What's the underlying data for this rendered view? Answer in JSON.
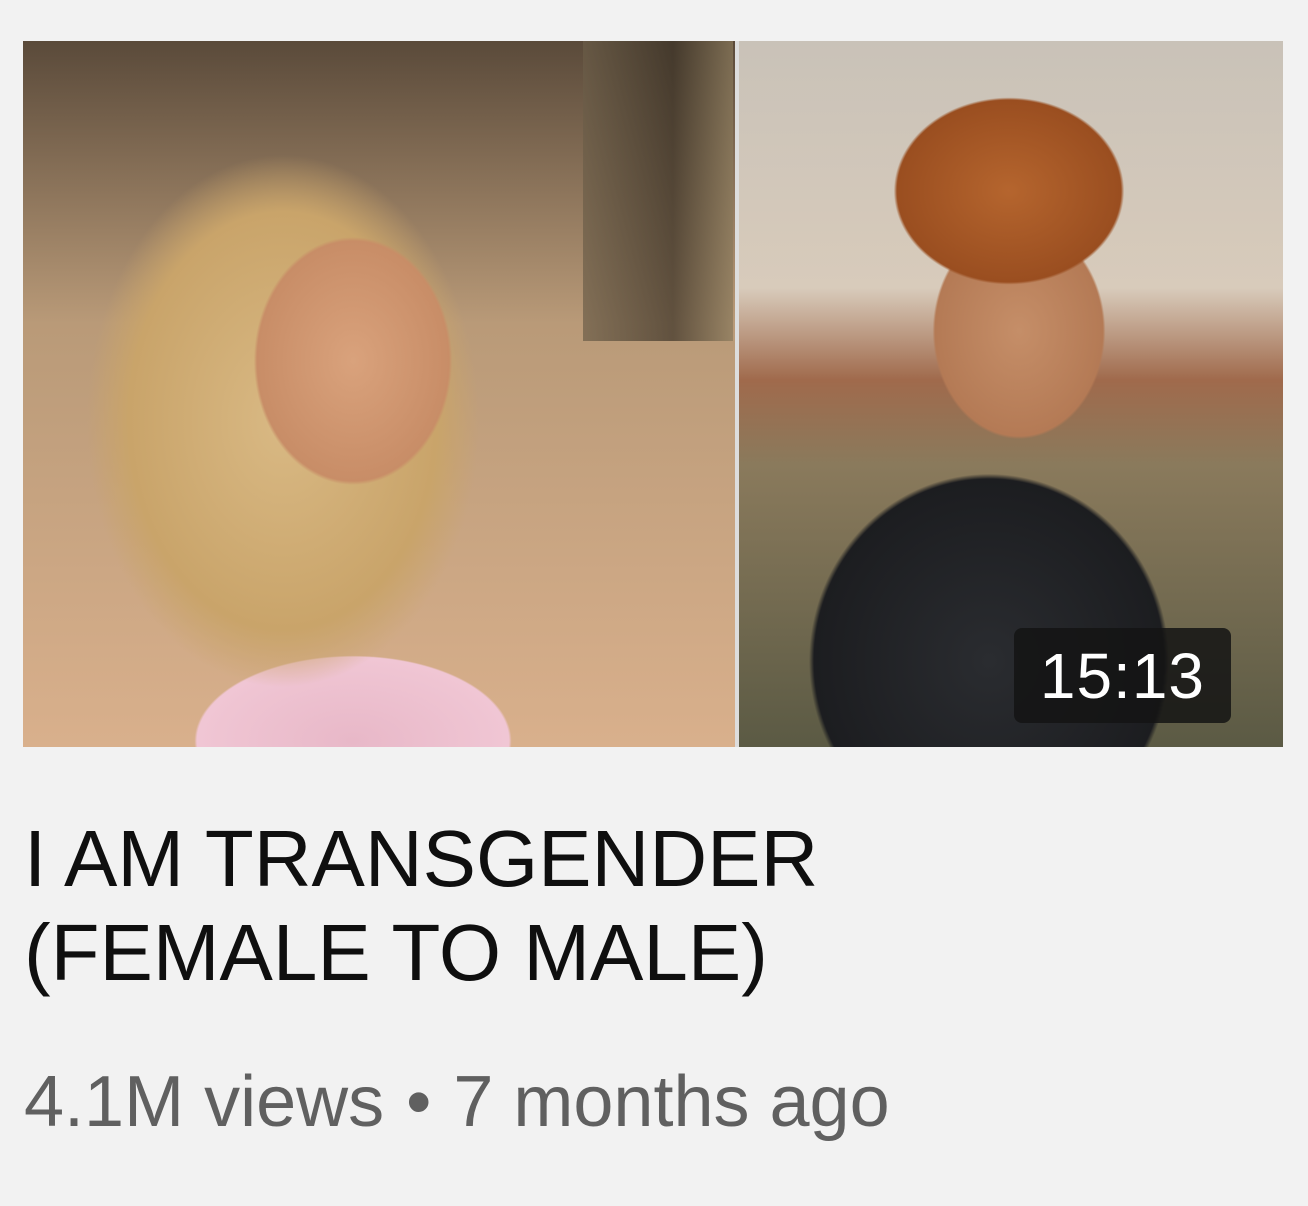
{
  "video": {
    "duration": "15:13",
    "title": "I AM TRANSGENDER (FEMALE TO MALE)",
    "views": "4.1M views",
    "separator": "•",
    "age": "7 months ago"
  }
}
